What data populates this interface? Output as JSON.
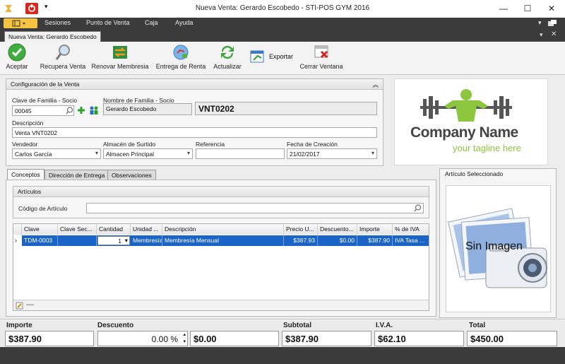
{
  "window": {
    "title": "Nueva Venta: Gerardo Escobedo - STI-POS GYM 2016"
  },
  "menu": [
    "Sesiones",
    "Punto de Venta",
    "Caja",
    "Ayuda"
  ],
  "doc_tab": "Nueva Venta: Gerardo Escobedo",
  "toolbar": {
    "aceptar": "Aceptar",
    "recupera": "Recupera Venta",
    "renovar": "Renovar Membresia",
    "entrega": "Entrega de Renta",
    "actualizar": "Actualizar",
    "exportar": "Exportar",
    "cerrar": "Cerrar Ventana"
  },
  "config": {
    "title": "Configuración de la Venta",
    "clave_label": "Clave de Familia - Socio",
    "clave_value": "00045",
    "nombre_label": "Nombre de Familia - Socio",
    "nombre_value": "Gerardo Escobedo",
    "folio": "VNT0202",
    "descripcion_label": "Descripción",
    "descripcion_value": "Venta VNT0202",
    "vendedor_label": "Vendedor",
    "vendedor_value": "Carlos  García",
    "almacen_label": "Almacén de Surtido",
    "almacen_value": "Almacen Principal",
    "referencia_label": "Referencia",
    "referencia_value": "",
    "fecha_label": "Fecha de Creación",
    "fecha_value": "21/02/2017"
  },
  "logo": {
    "company": "Company Name",
    "tagline": "your tagline here"
  },
  "tabs": [
    "Conceptos",
    "Dirección de Entrega",
    "Observaciones"
  ],
  "articulos": {
    "title": "Artículos",
    "codigo_label": "Código de Artículo",
    "codigo_value": ""
  },
  "grid": {
    "headers": [
      "Clave",
      "Clave Sec...",
      "Cantidad",
      "Unidad ...",
      "Descripción",
      "Precio U...",
      "Descuento...",
      "Importe",
      "% de IVA"
    ],
    "rows": [
      {
        "clave": "TDM-0003",
        "clave_sec": "",
        "cantidad": "1",
        "unidad": "Membresía",
        "descripcion": "Membresía Mensual",
        "precio": "$387.93",
        "descuento": "$0.00",
        "importe": "$387.90",
        "iva": "IVA Tasa ..."
      }
    ]
  },
  "selected_article": {
    "title": "Artículo Seleccionado",
    "no_image": "Sin Imagen"
  },
  "totals": {
    "importe_label": "Importe",
    "importe_value": "$387.90",
    "descuento_label": "Descuento",
    "descuento_pct": "0.00 %",
    "descuento_value": "$0.00",
    "subtotal_label": "Subtotal",
    "subtotal_value": "$387.90",
    "iva_label": "I.V.A.",
    "iva_value": "$62.10",
    "total_label": "Total",
    "total_value": "$450.00"
  },
  "colors": {
    "accent": "#1a63c7",
    "dark_bar": "#3b3b3b",
    "logo_green": "#8cc63f"
  }
}
